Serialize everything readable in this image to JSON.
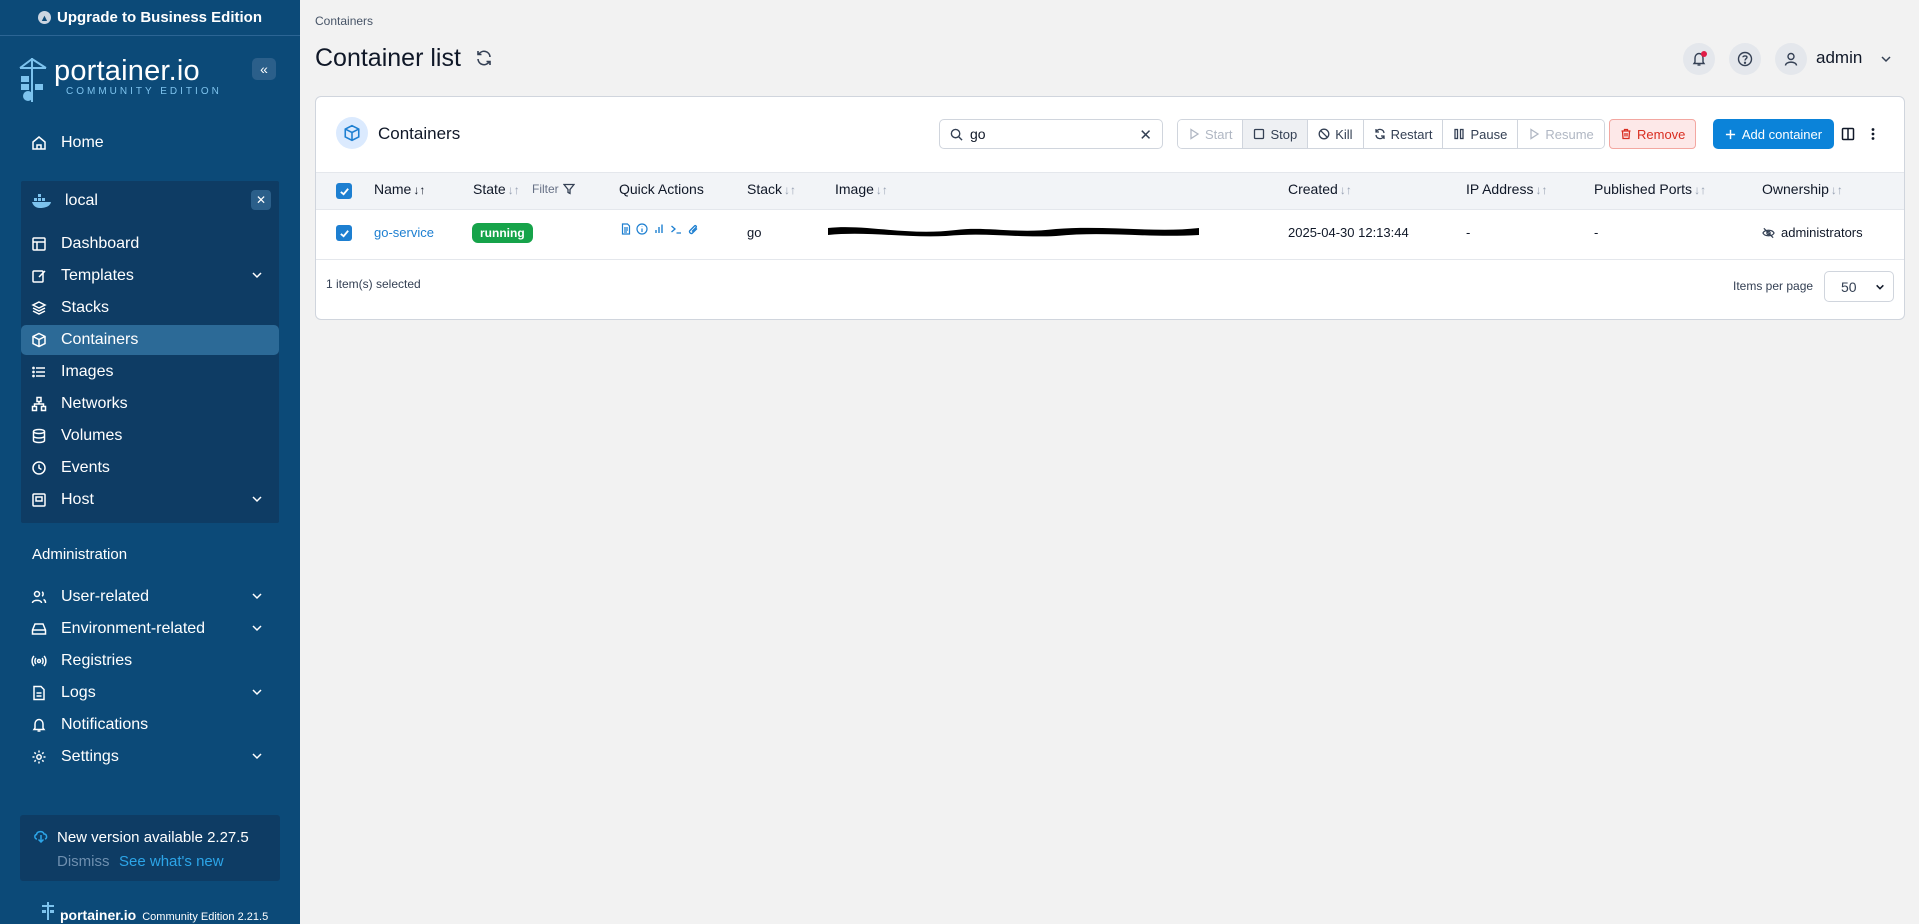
{
  "sidebar": {
    "upgrade_label": "Upgrade to Business Edition",
    "brand": {
      "name": "portainer.io",
      "edition": "COMMUNITY EDITION"
    },
    "collapse_glyph": "«",
    "home_label": "Home",
    "environment": {
      "name": "local",
      "close_glyph": "✕"
    },
    "env_items": [
      {
        "label": "Dashboard",
        "icon": "dashboard-icon"
      },
      {
        "label": "Templates",
        "icon": "edit-icon",
        "has_children": true
      },
      {
        "label": "Stacks",
        "icon": "layers-icon"
      },
      {
        "label": "Containers",
        "icon": "box-icon",
        "active": true
      },
      {
        "label": "Images",
        "icon": "list-icon"
      },
      {
        "label": "Networks",
        "icon": "network-icon"
      },
      {
        "label": "Volumes",
        "icon": "database-icon"
      },
      {
        "label": "Events",
        "icon": "clock-icon"
      },
      {
        "label": "Host",
        "icon": "host-icon",
        "has_children": true
      }
    ],
    "admin_heading": "Administration",
    "admin_items": [
      {
        "label": "User-related",
        "icon": "users-icon",
        "has_children": true
      },
      {
        "label": "Environment-related",
        "icon": "drive-icon",
        "has_children": true
      },
      {
        "label": "Registries",
        "icon": "radio-icon"
      },
      {
        "label": "Logs",
        "icon": "file-icon",
        "has_children": true
      },
      {
        "label": "Notifications",
        "icon": "bell-icon"
      },
      {
        "label": "Settings",
        "icon": "gear-icon",
        "has_children": true
      }
    ],
    "update": {
      "title": "New version available 2.27.5",
      "dismiss": "Dismiss",
      "whats_new": "See what's new"
    },
    "footer": {
      "name": "portainer.io",
      "version": "Community Edition  2.21.5"
    }
  },
  "header": {
    "breadcrumb": "Containers",
    "title": "Container list",
    "username": "admin"
  },
  "card": {
    "title": "Containers",
    "search": {
      "value": "go",
      "clear_glyph": "✕"
    },
    "actions": [
      {
        "label": "Start",
        "state": "disabled"
      },
      {
        "label": "Stop",
        "state": "pressed"
      },
      {
        "label": "Kill",
        "state": "normal"
      },
      {
        "label": "Restart",
        "state": "normal"
      },
      {
        "label": "Pause",
        "state": "normal"
      },
      {
        "label": "Resume",
        "state": "disabled"
      }
    ],
    "remove_label": "Remove",
    "add_label": "Add container",
    "columns": {
      "name": "Name",
      "state": "State",
      "filter": "Filter",
      "quick_actions": "Quick Actions",
      "stack": "Stack",
      "image": "Image",
      "created": "Created",
      "ip": "IP Address",
      "ports": "Published Ports",
      "ownership": "Ownership"
    },
    "sort_glyph": "↓↑",
    "name_sort_glyph": "↓↑",
    "rows": [
      {
        "name": "go-service",
        "state": "running",
        "stack": "go",
        "created": "2025-04-30 12:13:44",
        "ip": "-",
        "ports": "-",
        "ownership": "administrators"
      }
    ],
    "selected_text": "1 item(s) selected",
    "items_per_page_label": "Items per page",
    "items_per_page": "50"
  },
  "colors": {
    "sidebar_bg": "#0c4a78",
    "accent": "#0b83d9",
    "running": "#16a34a",
    "danger": "#d92d20"
  }
}
